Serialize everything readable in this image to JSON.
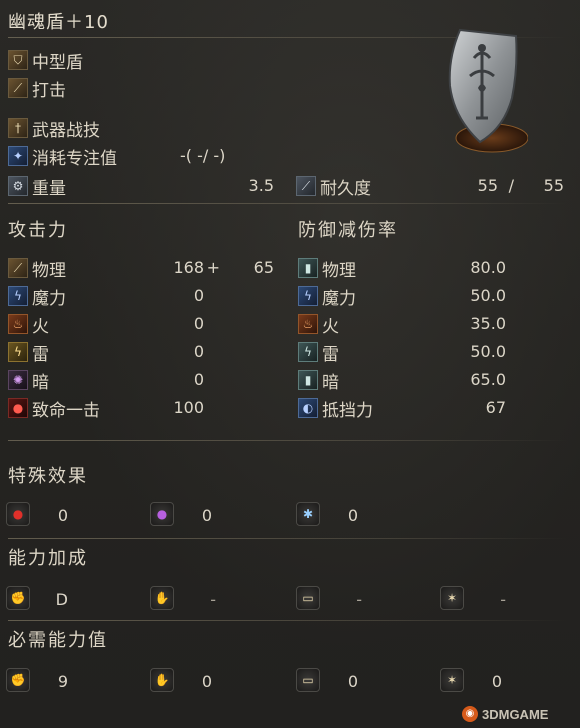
{
  "item": {
    "name": "幽魂盾＋10",
    "type": "中型盾",
    "attack_type": "打击",
    "skill_label": "武器战技",
    "fp_label": "消耗专注值",
    "fp_value": "-(    -/    -)",
    "weight_label": "重量",
    "weight_value": "3.5",
    "durability_label": "耐久度",
    "durability_current": "55",
    "durability_sep": "/",
    "durability_max": "55"
  },
  "attack": {
    "header": "攻击力",
    "rows": [
      {
        "label": "物理",
        "value": "168",
        "plus": "+",
        "bonus": "65",
        "icon": "physical-attack-icon"
      },
      {
        "label": "魔力",
        "value": "0",
        "icon": "magic-attack-icon"
      },
      {
        "label": "火",
        "value": "0",
        "icon": "fire-attack-icon"
      },
      {
        "label": "雷",
        "value": "0",
        "icon": "lightning-attack-icon"
      },
      {
        "label": "暗",
        "value": "0",
        "icon": "dark-attack-icon"
      },
      {
        "label": "致命一击",
        "value": "100",
        "icon": "critical-icon"
      }
    ]
  },
  "defense": {
    "header": "防御减伤率",
    "rows": [
      {
        "label": "物理",
        "value": "80.0",
        "icon": "physical-defense-icon"
      },
      {
        "label": "魔力",
        "value": "50.0",
        "icon": "magic-defense-icon"
      },
      {
        "label": "火",
        "value": "35.0",
        "icon": "fire-defense-icon"
      },
      {
        "label": "雷",
        "value": "50.0",
        "icon": "lightning-defense-icon"
      },
      {
        "label": "暗",
        "value": "65.0",
        "icon": "dark-defense-icon"
      },
      {
        "label": "抵挡力",
        "value": "67",
        "icon": "stability-icon"
      }
    ]
  },
  "effects": {
    "header": "特殊效果",
    "values": [
      "0",
      "0",
      "0"
    ],
    "icons": [
      "bleed-effect-icon",
      "poison-effect-icon",
      "frost-effect-icon"
    ]
  },
  "scaling": {
    "header": "能力加成",
    "values": [
      "D",
      "-",
      "-",
      "-"
    ],
    "icons": [
      "strength-icon",
      "dexterity-icon",
      "intelligence-icon",
      "faith-icon"
    ]
  },
  "requirements": {
    "header": "必需能力值",
    "values": [
      "9",
      "0",
      "0",
      "0"
    ],
    "icons": [
      "strength-icon",
      "dexterity-icon",
      "intelligence-icon",
      "faith-icon"
    ]
  },
  "watermark": "3DMGAME",
  "colors": {
    "background": "#252421",
    "text": "#ddd6c6",
    "accent": "#a8976f"
  }
}
